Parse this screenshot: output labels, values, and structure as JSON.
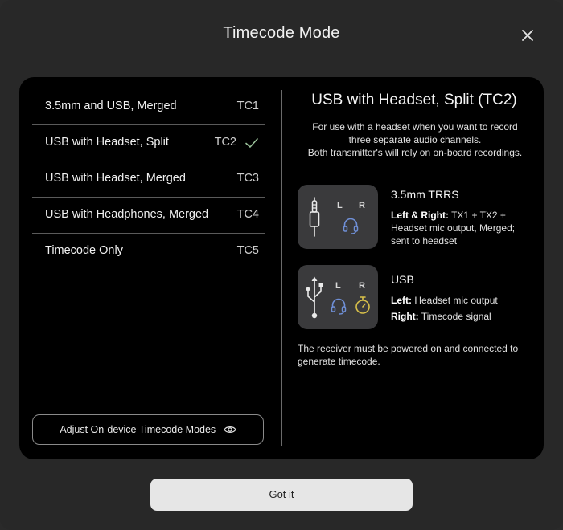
{
  "dialog": {
    "title": "Timecode Mode",
    "close_icon": "close-icon",
    "confirm_label": "Got it"
  },
  "modes": [
    {
      "label": "3.5mm and USB, Merged",
      "code": "TC1",
      "selected": false
    },
    {
      "label": "USB with Headset, Split",
      "code": "TC2",
      "selected": true
    },
    {
      "label": "USB with Headset, Merged",
      "code": "TC3",
      "selected": false
    },
    {
      "label": "USB with Headphones, Merged",
      "code": "TC4",
      "selected": false
    },
    {
      "label": "Timecode Only",
      "code": "TC5",
      "selected": false
    }
  ],
  "adjust_button": {
    "label": "Adjust On-device Timecode Modes",
    "icon": "eye-icon"
  },
  "detail": {
    "title": "USB with Headset, Split (TC2)",
    "description_line1": "For use with a headset when you want to record",
    "description_line2": "three separate audio channels.",
    "description_line3": "Both transmitter's will rely on on-board recordings.",
    "connections": [
      {
        "name": "3.5mm TRRS",
        "icon": "trrs-plug-icon",
        "left_label": "L",
        "right_label": "R",
        "channel_icon": "headset-icon",
        "desc_bold": "Left & Right:",
        "desc_text": " TX1 + TX2 + Headset mic output, Merged; sent to headset"
      },
      {
        "name": "USB",
        "icon": "usb-icon",
        "left_label": "L",
        "right_label": "R",
        "left_channel_icon": "headset-icon",
        "right_channel_icon": "stopwatch-icon",
        "left_bold": "Left:",
        "left_text": " Headset mic output",
        "right_bold": "Right:",
        "right_text": " Timecode signal"
      }
    ],
    "note": "The receiver must be powered on and connected to generate timecode."
  },
  "colors": {
    "background": "#282828",
    "panel": "#000000",
    "card": "#3a3a3c",
    "headset_accent": "#6f8fd6",
    "timecode_accent": "#d9c14a",
    "check_accent": "#9bc39b",
    "button": "#e6e6e6"
  }
}
